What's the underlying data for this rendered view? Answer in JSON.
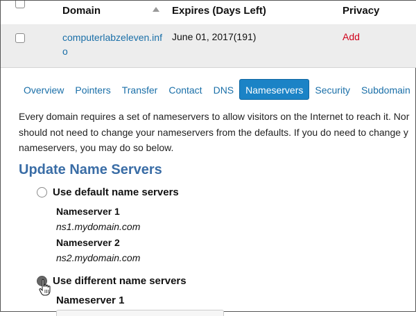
{
  "table": {
    "headers": {
      "domain": "Domain",
      "expires": "Expires (Days Left)",
      "privacy": "Privacy"
    },
    "row": {
      "domain": "computerlabzeleven.info",
      "expires": "June 01, 2017(191)",
      "privacy": "Add"
    }
  },
  "tabs": [
    {
      "label": "Overview"
    },
    {
      "label": "Pointers"
    },
    {
      "label": "Transfer"
    },
    {
      "label": "Contact"
    },
    {
      "label": "DNS"
    },
    {
      "label": "Nameservers",
      "active": true
    },
    {
      "label": "Security"
    },
    {
      "label": "Subdomain"
    }
  ],
  "intro": {
    "line1": "Every domain requires a set of nameservers to allow visitors on the Internet to reach it. Nor",
    "line2": "should not need to change your nameservers from the defaults. If you do need to change y",
    "line3": "nameservers, you may do so below."
  },
  "section_title": "Update Name Servers",
  "options": {
    "default_label": "Use default name servers",
    "different_label": "Use different name servers"
  },
  "default_servers": [
    {
      "title": "Nameserver 1",
      "value": "ns1.mydomain.com"
    },
    {
      "title": "Nameserver 2",
      "value": "ns2.mydomain.com"
    }
  ],
  "different_servers": [
    {
      "title": "Nameserver 1"
    }
  ],
  "colors": {
    "link": "#1a6fa8",
    "accent": "#1b83c6",
    "privacy": "#d0021b",
    "heading": "#3a6da6"
  }
}
